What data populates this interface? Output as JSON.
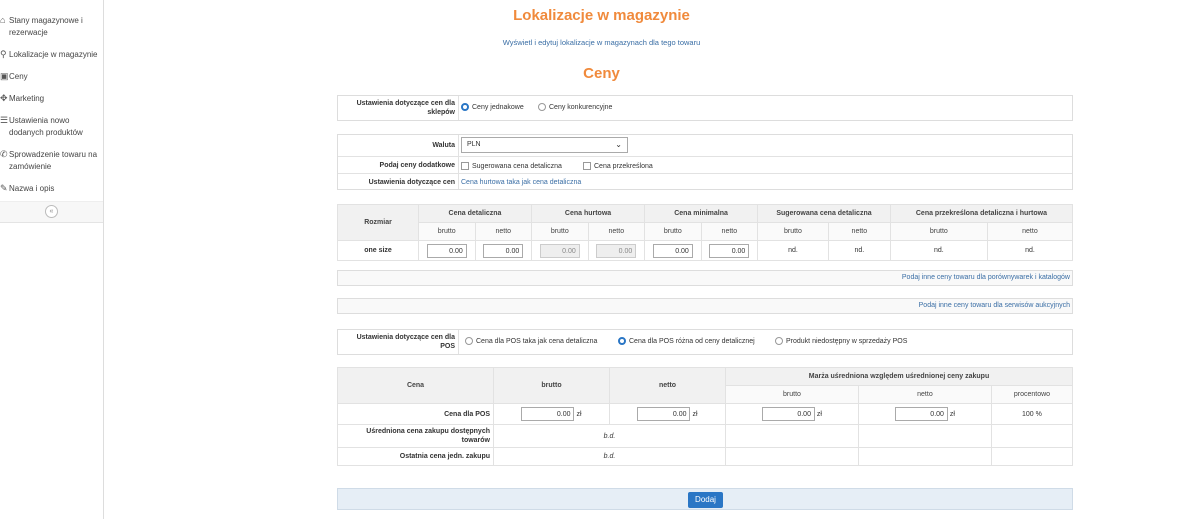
{
  "sidebar": {
    "items": [
      {
        "icon": "house-icon",
        "label": "Stany magazynowe i rezerwacje"
      },
      {
        "icon": "location-pin-icon",
        "label": "Lokalizacje w magazynie"
      },
      {
        "icon": "price-icon",
        "label": "Ceny"
      },
      {
        "icon": "puzzle-icon",
        "label": "Marketing"
      },
      {
        "icon": "list-icon",
        "label": "Ustawienia nowo dodanych produktów"
      },
      {
        "icon": "phone-icon",
        "label": "Sprowadzenie towaru na zamówienie"
      },
      {
        "icon": "edit-icon",
        "label": "Nazwa i opis"
      }
    ],
    "collapse_symbol": "«"
  },
  "header": {
    "title": "Lokalizacje w magazynie",
    "subtitle": "Wyświetl i edytuj lokalizacje w magazynach dla tego towaru",
    "section": "Ceny"
  },
  "shop_settings": {
    "label": "Ustawienia dotyczące cen dla sklepów",
    "opt1": "Ceny jednakowe",
    "opt2": "Ceny konkurencyjne"
  },
  "currency_panel": {
    "waluta_label": "Waluta",
    "waluta_value": "PLN",
    "extra_label": "Podaj ceny dodatkowe",
    "extra_opt1": "Sugerowana cena detaliczna",
    "extra_opt2": "Cena przekreślona",
    "settings_label": "Ustawienia dotyczące cen",
    "settings_link": "Cena hurtowa taka jak cena detaliczna"
  },
  "price_table": {
    "col_size": "Rozmiar",
    "groups": [
      "Cena detaliczna",
      "Cena hurtowa",
      "Cena minimalna",
      "Sugerowana cena detaliczna",
      "Cena przekreślona detaliczna i hurtowa"
    ],
    "brutto": "brutto",
    "netto": "netto",
    "size": "one size",
    "values": [
      "0.00",
      "0.00",
      "0.00",
      "0.00",
      "0.00",
      "0.00",
      "nd.",
      "nd.",
      "nd.",
      "nd."
    ]
  },
  "links": {
    "compare": "Podaj inne ceny towaru dla porównywarek i katalogów",
    "auction": "Podaj inne ceny towaru dla serwisów aukcyjnych"
  },
  "pos_settings": {
    "label": "Ustawienia dotyczące cen dla POS",
    "opt1": "Cena dla POS taka jak cena detaliczna",
    "opt2": "Cena dla POS różna od ceny detalicznej",
    "opt3": "Produkt niedostępny w sprzedaży POS"
  },
  "pos_table": {
    "col_cena": "Cena",
    "col_brutto": "brutto",
    "col_netto": "netto",
    "col_marza": "Marża uśredniona względem uśrednionej ceny zakupu",
    "sub_brutto": "brutto",
    "sub_netto": "netto",
    "sub_pct": "procentowo",
    "row1_label": "Cena dla POS",
    "row1_vals": [
      "0.00",
      "0.00",
      "0.00",
      "0.00"
    ],
    "currency": "zł",
    "row1_pct": "100 %",
    "row2_label": "Uśredniona cena zakupu dostępnych towarów",
    "row2_val": "b.d.",
    "row3_label": "Ostatnia cena jedn. zakupu",
    "row3_val": "b.d."
  },
  "submit": {
    "label": "Dodaj"
  },
  "colors": {
    "accent": "#f08a3c",
    "link": "#3a6ea5",
    "button": "#2a76c5"
  }
}
